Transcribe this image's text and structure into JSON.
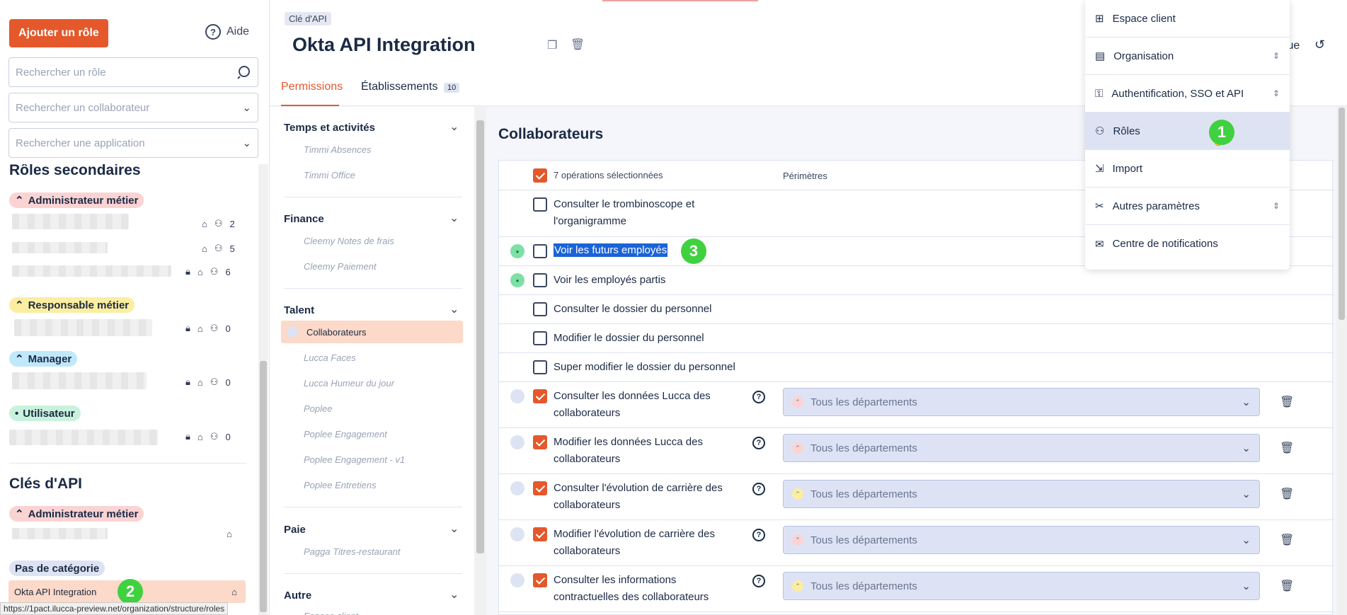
{
  "left": {
    "add_role": "Ajouter un rôle",
    "help": "Aide",
    "search_role": "Rechercher un rôle",
    "search_collab": "Rechercher un collaborateur",
    "search_app": "Rechercher une application",
    "section_secondary": "Rôles secondaires",
    "section_api": "Clés d'API",
    "roles": [
      {
        "label": "Administrateur métier",
        "badge": "⌃",
        "rows": [
          {
            "locked": false,
            "count": "2"
          },
          {
            "locked": false,
            "count": "5"
          },
          {
            "locked": true,
            "count": "6"
          }
        ]
      },
      {
        "label": "Responsable métier",
        "badge": "⌃",
        "rows": [
          {
            "locked": true,
            "count": "0"
          }
        ]
      },
      {
        "label": "Manager",
        "badge": "⌃",
        "rows": [
          {
            "locked": true,
            "count": "0"
          }
        ]
      },
      {
        "label": "Utilisateur",
        "badge": "•",
        "rows": [
          {
            "locked": true,
            "count": "0"
          }
        ]
      }
    ],
    "api_admin": "Administrateur métier",
    "no_category": "Pas de catégorie",
    "okta_item": "Okta API Integration"
  },
  "header": {
    "tag": "Clé d'API",
    "title": "Okta API Integration",
    "tab_permissions": "Permissions",
    "tab_etabs": "Établissements",
    "tab_etabs_count": "10",
    "history_partial": "ique"
  },
  "categories": {
    "groups": [
      {
        "title": "Temps et activités",
        "items": [
          "Timmi Absences",
          "Timmi Office"
        ]
      },
      {
        "title": "Finance",
        "items": [
          "Cleemy Notes de frais",
          "Cleemy Paiement"
        ]
      },
      {
        "title": "Talent",
        "items": [
          "Collaborateurs",
          "Lucca Faces",
          "Lucca Humeur du jour",
          "Poplee",
          "Poplee Engagement",
          "Poplee Engagement - v1",
          "Poplee Entretiens"
        ]
      },
      {
        "title": "Paie",
        "items": [
          "Pagga Titres-restaurant"
        ]
      },
      {
        "title": "Autre",
        "items": [
          "Espace client"
        ]
      }
    ]
  },
  "perms": {
    "title": "Collaborateurs",
    "selected_count": "7 opérations sélectionnées",
    "col_perimeter": "Périmètres",
    "rows": [
      {
        "label": "Consulter le trombinoscope et l'organigramme",
        "line2": "",
        "checked": false
      },
      {
        "label": "Voir les futurs employés",
        "checked": false,
        "highlight": true
      },
      {
        "label": "Voir les employés partis",
        "checked": false
      },
      {
        "label": "Consulter le dossier du personnel",
        "checked": false
      },
      {
        "label": "Modifier le dossier du personnel",
        "checked": false
      },
      {
        "label": "Super modifier le dossier du personnel",
        "checked": false
      },
      {
        "label": "Consulter les données Lucca des collaborateurs",
        "checked": true,
        "perimeter": "Tous les départements",
        "badge": "admin"
      },
      {
        "label": "Modifier les données Lucca des collaborateurs",
        "checked": true,
        "perimeter": "Tous les départements",
        "badge": "admin"
      },
      {
        "label": "Consulter l'évolution de carrière des collaborateurs",
        "checked": true,
        "perimeter": "Tous les départements",
        "badge": "resp"
      },
      {
        "label": "Modifier l'évolution de carrière des collaborateurs",
        "checked": true,
        "perimeter": "Tous les départements",
        "badge": "admin"
      },
      {
        "label": "Consulter les informations contractuelles des collaborateurs",
        "checked": true,
        "perimeter": "Tous les départements",
        "badge": "resp"
      }
    ]
  },
  "menu": {
    "items": [
      "Espace client",
      "Organisation",
      "Authentification, SSO et API",
      "Rôles",
      "Import",
      "Autres paramètres",
      "Centre de notifications"
    ]
  },
  "markers": [
    "1",
    "2",
    "3"
  ],
  "status_url": "https://1pact.ilucca-preview.net/organization/structure/roles",
  "colors": {
    "accent": "#e4582b",
    "marker": "#3fd13f"
  }
}
